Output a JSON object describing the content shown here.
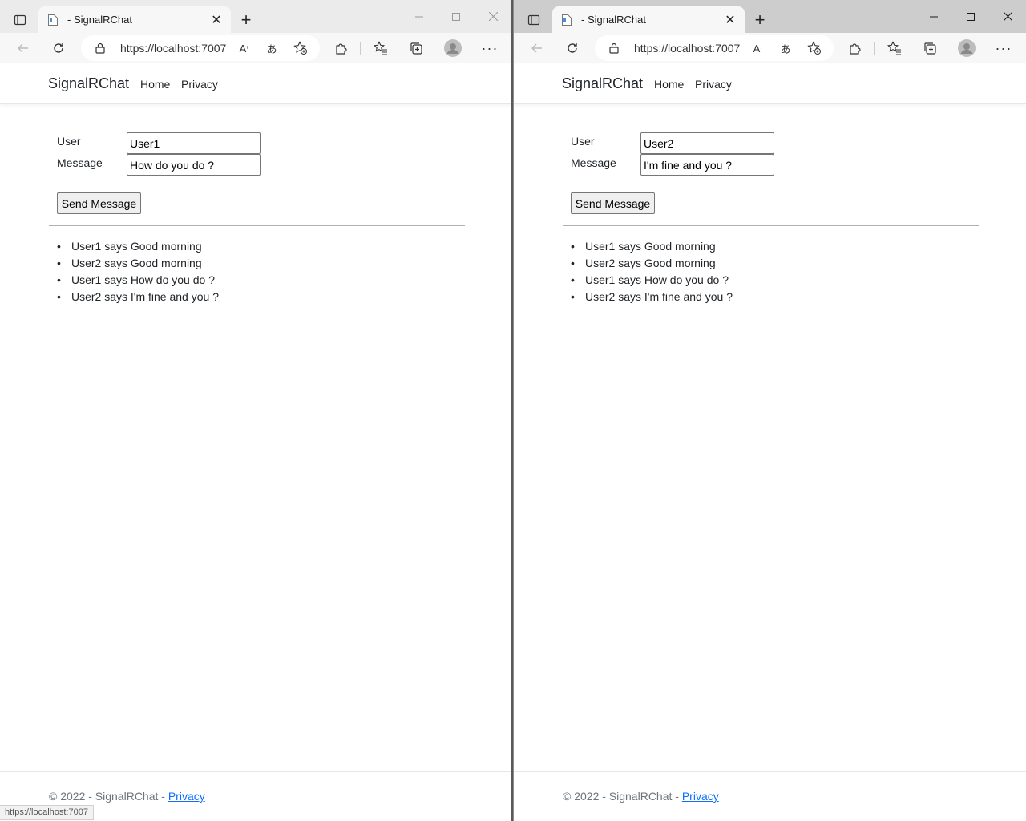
{
  "windows": [
    {
      "tab_title": "- SignalRChat",
      "url": "https://localhost:7007",
      "brand": "SignalRChat",
      "nav": [
        "Home",
        "Privacy"
      ],
      "form": {
        "user_label": "User",
        "user_value": "User1",
        "message_label": "Message",
        "message_value": "How do you do ?",
        "send_label": "Send Message"
      },
      "messages": [
        "User1 says Good morning",
        "User2 says Good morning",
        "User1 says How do you do ?",
        "User2 says I'm fine and you ?"
      ],
      "footer": {
        "text": "© 2022 - SignalRChat - ",
        "link": "Privacy"
      },
      "status_url": "https://localhost:7007"
    },
    {
      "tab_title": "- SignalRChat",
      "url": "https://localhost:7007",
      "brand": "SignalRChat",
      "nav": [
        "Home",
        "Privacy"
      ],
      "form": {
        "user_label": "User",
        "user_value": "User2",
        "message_label": "Message",
        "message_value": "I'm fine and you ?",
        "send_label": "Send Message"
      },
      "messages": [
        "User1 says Good morning",
        "User2 says Good morning",
        "User1 says How do you do ?",
        "User2 says I'm fine and you ?"
      ],
      "footer": {
        "text": "© 2022 - SignalRChat - ",
        "link": "Privacy"
      }
    }
  ],
  "icons": {
    "tab_actions": "tab-actions-icon",
    "favicon": "page-icon",
    "close": "close-icon",
    "new_tab": "plus-icon",
    "back": "back-arrow-icon",
    "refresh": "refresh-icon",
    "lock": "lock-icon",
    "read_aloud": "read-aloud-icon",
    "translate": "translate-icon",
    "add_favorite": "add-favorite-icon",
    "extensions": "puzzle-icon",
    "favorites": "favorites-icon",
    "collections": "collections-icon",
    "profile": "avatar-icon",
    "more": "more-icon"
  },
  "colors": {
    "link": "#0d6efd",
    "text": "#212529",
    "muted": "#6c757d"
  }
}
